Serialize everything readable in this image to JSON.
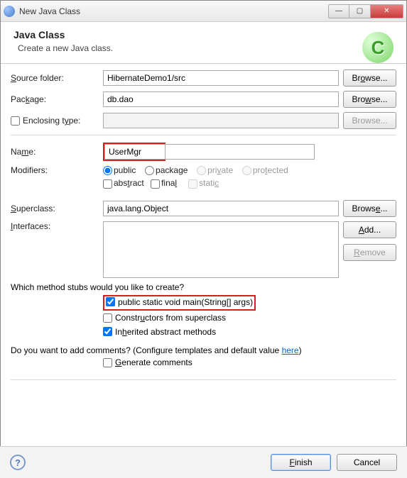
{
  "window": {
    "title": "New Java Class"
  },
  "banner": {
    "heading": "Java Class",
    "sub": "Create a new Java class.",
    "icon_letter": "C"
  },
  "fields": {
    "source_folder_label": "Source folder:",
    "source_folder_value": "HibernateDemo1/src",
    "package_label": "Package:",
    "package_value": "db.dao",
    "enclosing_label": "Enclosing type:",
    "enclosing_value": "",
    "name_label": "Name:",
    "name_value": "UserMgr",
    "modifiers_label": "Modifiers:",
    "superclass_label": "Superclass:",
    "superclass_value": "java.lang.Object",
    "interfaces_label": "Interfaces:"
  },
  "buttons": {
    "browse": "Browse...",
    "add": "Add...",
    "remove": "Remove",
    "finish": "Finish",
    "cancel": "Cancel"
  },
  "modifiers": {
    "public": "public",
    "package": "package",
    "private": "private",
    "protected": "protected",
    "abstract": "abstract",
    "final": "final",
    "static": "static"
  },
  "stubs": {
    "question": "Which method stubs would you like to create?",
    "main": "public static void main(String[] args)",
    "constructors": "Constructors from superclass",
    "inherited": "Inherited abstract methods"
  },
  "comments": {
    "question_pre": "Do you want to add comments? (Configure templates and default value ",
    "link": "here",
    "question_post": ")",
    "generate": "Generate comments"
  }
}
